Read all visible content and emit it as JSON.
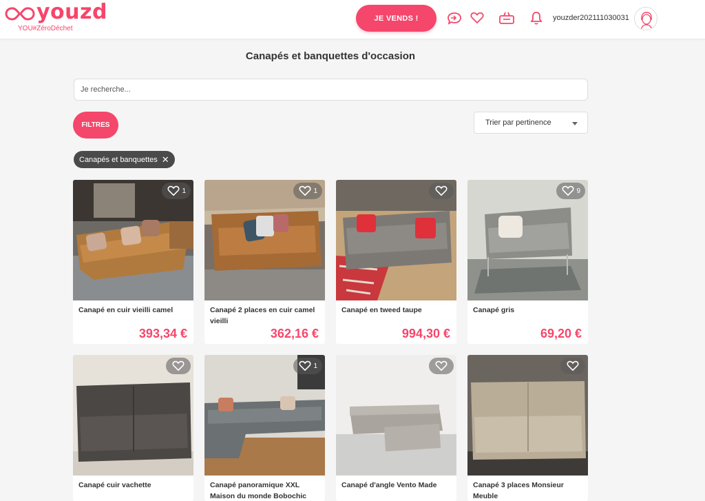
{
  "brand": {
    "name": "youzd",
    "tagline": "YOU#ZéroDéchet",
    "color": "#f5466b"
  },
  "header": {
    "sell_label": "JE VENDS !",
    "icons": [
      "message-icon",
      "heart-icon",
      "basket-icon",
      "bell-icon"
    ],
    "username": "youzder202111030031"
  },
  "page": {
    "title": "Canapés et banquettes d'occasion",
    "search_placeholder": "Je recherche...",
    "filters_label": "FILTRES",
    "sort_label": "Trier par pertinence",
    "chip_label": "Canapés et banquettes",
    "chip_close": "✕"
  },
  "products": [
    {
      "title": "Canapé en cuir vieilli camel",
      "price": "393,34 €",
      "likes": "1"
    },
    {
      "title": "Canapé 2 places en cuir camel vieilli",
      "price": "362,16 €",
      "likes": "1"
    },
    {
      "title": "Canapé en tweed taupe",
      "price": "994,30 €",
      "likes": ""
    },
    {
      "title": "Canapé gris",
      "price": "69,20 €",
      "likes": "9"
    },
    {
      "title": "Canapé cuir vachette",
      "price": "",
      "likes": ""
    },
    {
      "title": "Canapé panoramique XXL Maison du monde Bobochic",
      "price": "",
      "likes": "1"
    },
    {
      "title": "Canapé d'angle Vento Made",
      "price": "",
      "likes": ""
    },
    {
      "title": "Canapé 3 places Monsieur Meuble",
      "price": "",
      "likes": ""
    }
  ]
}
